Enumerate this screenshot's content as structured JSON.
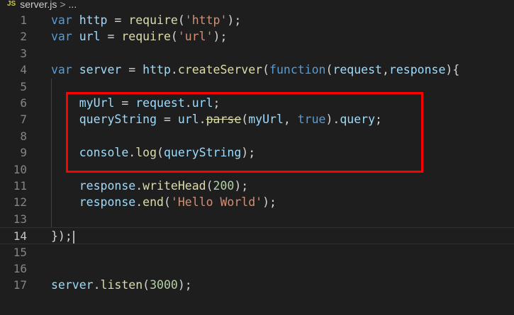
{
  "breadcrumb": {
    "file_icon": "JS",
    "file_name": "server.js",
    "separator": ">",
    "more": "..."
  },
  "editor": {
    "language": "javascript",
    "current_line": 14,
    "lines": [
      {
        "number": "1",
        "text": "var http = require('http');"
      },
      {
        "number": "2",
        "text": "var url = require('url');"
      },
      {
        "number": "3",
        "text": ""
      },
      {
        "number": "4",
        "text": "var server = http.createServer(function(request,response){"
      },
      {
        "number": "5",
        "text": ""
      },
      {
        "number": "6",
        "text": "    myUrl = request.url;"
      },
      {
        "number": "7",
        "text": "    queryString = url.parse(myUrl, true).query;"
      },
      {
        "number": "8",
        "text": ""
      },
      {
        "number": "9",
        "text": "    console.log(queryString);"
      },
      {
        "number": "10",
        "text": ""
      },
      {
        "number": "11",
        "text": "    response.writeHead(200);"
      },
      {
        "number": "12",
        "text": "    response.end('Hello World');"
      },
      {
        "number": "13",
        "text": ""
      },
      {
        "number": "14",
        "text": "});"
      },
      {
        "number": "15",
        "text": ""
      },
      {
        "number": "16",
        "text": ""
      },
      {
        "number": "17",
        "text": "server.listen(3000);"
      }
    ]
  },
  "annotation": {
    "highlight_color": "#ff0000",
    "highlighted_lines": [
      6,
      9
    ]
  },
  "theme": {
    "background": "#1e1e1e",
    "keyword": "#569cd6",
    "variable": "#9cdcfe",
    "function": "#dcdcaa",
    "string": "#ce9178",
    "number": "#b5cea8"
  }
}
